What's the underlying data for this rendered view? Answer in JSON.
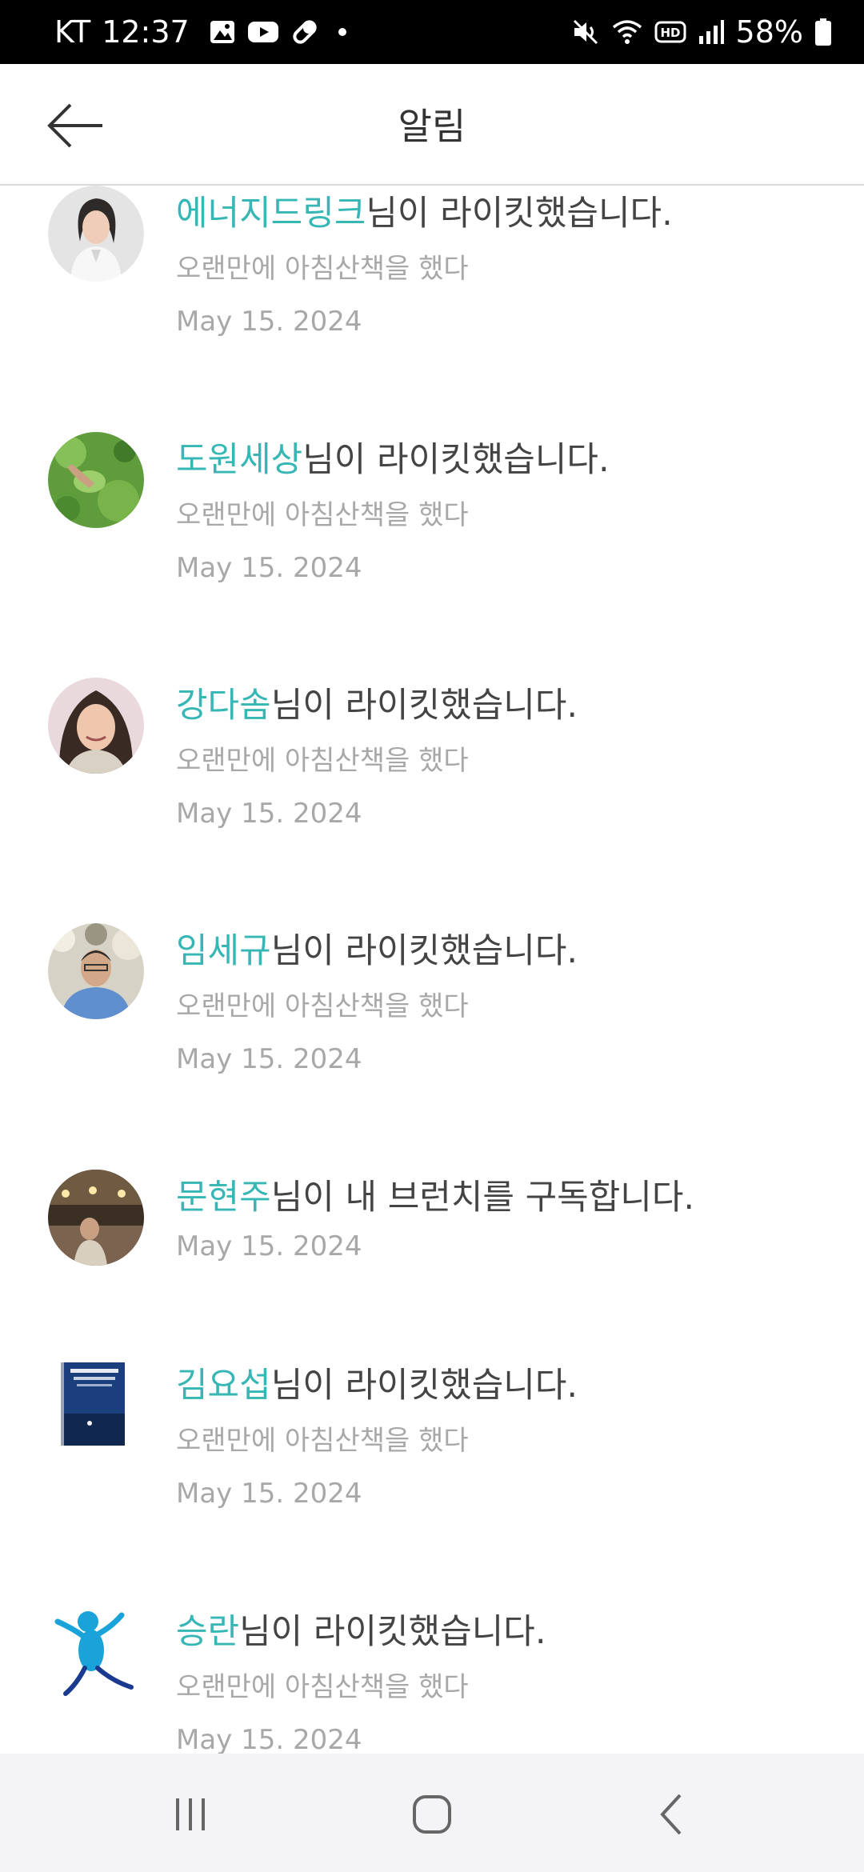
{
  "status_bar": {
    "carrier": "KT",
    "time": "12:37",
    "battery": "58%",
    "icons_left": [
      "gallery-icon",
      "youtube-icon",
      "pill-icon",
      "dot-icon"
    ],
    "icons_right": [
      "mute-icon",
      "wifi-icon",
      "hd-icon",
      "signal-icon",
      "battery-icon"
    ]
  },
  "header": {
    "title": "알림",
    "back_icon": "arrow-left-icon"
  },
  "notifications": [
    {
      "name": "에너지드링크",
      "action": "님이 라이킷했습니다.",
      "preview": "오랜만에 아침산책을 했다",
      "date": "May 15. 2024"
    },
    {
      "name": "도원세상",
      "action": "님이 라이킷했습니다.",
      "preview": "오랜만에 아침산책을 했다",
      "date": "May 15. 2024"
    },
    {
      "name": "강다솜",
      "action": "님이 라이킷했습니다.",
      "preview": "오랜만에 아침산책을 했다",
      "date": "May 15. 2024"
    },
    {
      "name": "임세규",
      "action": "님이 라이킷했습니다.",
      "preview": "오랜만에 아침산책을 했다",
      "date": "May 15. 2024"
    },
    {
      "name": "문현주",
      "action": "님이 내 브런치를 구독합니다.",
      "preview": "",
      "date": "May 15. 2024"
    },
    {
      "name": "김요섭",
      "action": "님이 라이킷했습니다.",
      "preview": "오랜만에 아침산책을 했다",
      "date": "May 15. 2024"
    },
    {
      "name": "승란",
      "action": "님이 라이킷했습니다.",
      "preview": "오랜만에 아침산책을 했다",
      "date": "May 15. 2024"
    }
  ],
  "nav_bar": {
    "icons": [
      "recent-apps-icon",
      "home-icon",
      "back-icon"
    ]
  },
  "colors": {
    "accent": "#36b7b5",
    "text": "#444444",
    "muted": "#a8a8a8"
  }
}
